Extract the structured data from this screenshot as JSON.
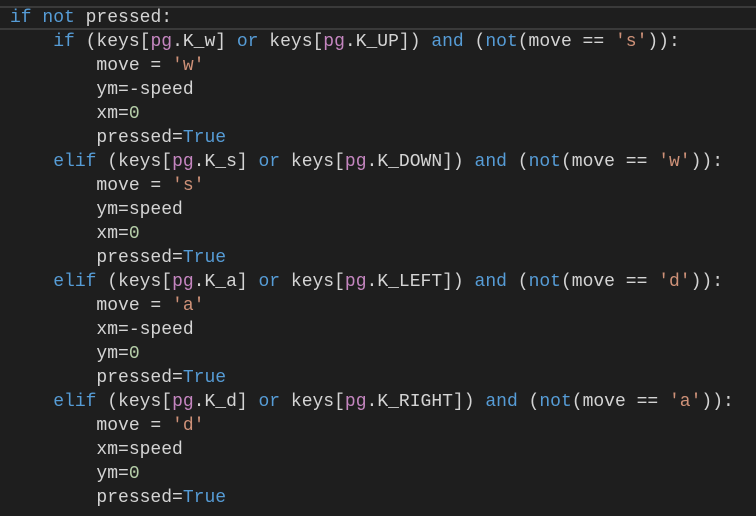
{
  "editor": {
    "colors": {
      "keyword": "#569cd6",
      "module": "#c586c0",
      "string": "#ce9178",
      "number": "#b5cea8",
      "text": "#d4d4d4",
      "background": "#1e1e1e"
    },
    "lines": [
      {
        "indent": 0,
        "current": true,
        "tokens": [
          [
            "kw",
            "if"
          ],
          [
            "txt",
            " "
          ],
          [
            "kw",
            "not"
          ],
          [
            "txt",
            " pressed:"
          ]
        ]
      },
      {
        "indent": 1,
        "tokens": [
          [
            "kw",
            "if"
          ],
          [
            "txt",
            " (keys["
          ],
          [
            "pg",
            "pg"
          ],
          [
            "txt",
            ".K_w] "
          ],
          [
            "kw",
            "or"
          ],
          [
            "txt",
            " keys["
          ],
          [
            "pg",
            "pg"
          ],
          [
            "txt",
            ".K_UP]) "
          ],
          [
            "kw",
            "and"
          ],
          [
            "txt",
            " ("
          ],
          [
            "kw",
            "not"
          ],
          [
            "txt",
            "(move == "
          ],
          [
            "str",
            "'s'"
          ],
          [
            "txt",
            "))："
          ]
        ]
      },
      {
        "indent": 2,
        "tokens": [
          [
            "txt",
            "move = "
          ],
          [
            "str",
            "'w'"
          ]
        ]
      },
      {
        "indent": 2,
        "tokens": [
          [
            "txt",
            "ym=-speed"
          ]
        ]
      },
      {
        "indent": 2,
        "tokens": [
          [
            "txt",
            "xm="
          ],
          [
            "num",
            "0"
          ]
        ]
      },
      {
        "indent": 2,
        "tokens": [
          [
            "txt",
            "pressed="
          ],
          [
            "kw",
            "True"
          ]
        ]
      },
      {
        "indent": 1,
        "tokens": [
          [
            "kw",
            "elif"
          ],
          [
            "txt",
            " (keys["
          ],
          [
            "pg",
            "pg"
          ],
          [
            "txt",
            ".K_s] "
          ],
          [
            "kw",
            "or"
          ],
          [
            "txt",
            " keys["
          ],
          [
            "pg",
            "pg"
          ],
          [
            "txt",
            ".K_DOWN]) "
          ],
          [
            "kw",
            "and"
          ],
          [
            "txt",
            " ("
          ],
          [
            "kw",
            "not"
          ],
          [
            "txt",
            "(move == "
          ],
          [
            "str",
            "'w'"
          ],
          [
            "txt",
            "))："
          ]
        ]
      },
      {
        "indent": 2,
        "tokens": [
          [
            "txt",
            "move = "
          ],
          [
            "str",
            "'s'"
          ]
        ]
      },
      {
        "indent": 2,
        "tokens": [
          [
            "txt",
            "ym=speed"
          ]
        ]
      },
      {
        "indent": 2,
        "tokens": [
          [
            "txt",
            "xm="
          ],
          [
            "num",
            "0"
          ]
        ]
      },
      {
        "indent": 2,
        "tokens": [
          [
            "txt",
            "pressed="
          ],
          [
            "kw",
            "True"
          ]
        ]
      },
      {
        "indent": 1,
        "tokens": [
          [
            "kw",
            "elif"
          ],
          [
            "txt",
            " (keys["
          ],
          [
            "pg",
            "pg"
          ],
          [
            "txt",
            ".K_a] "
          ],
          [
            "kw",
            "or"
          ],
          [
            "txt",
            " keys["
          ],
          [
            "pg",
            "pg"
          ],
          [
            "txt",
            ".K_LEFT]) "
          ],
          [
            "kw",
            "and"
          ],
          [
            "txt",
            " ("
          ],
          [
            "kw",
            "not"
          ],
          [
            "txt",
            "(move == "
          ],
          [
            "str",
            "'d'"
          ],
          [
            "txt",
            "))："
          ]
        ]
      },
      {
        "indent": 2,
        "tokens": [
          [
            "txt",
            "move = "
          ],
          [
            "str",
            "'a'"
          ]
        ]
      },
      {
        "indent": 2,
        "tokens": [
          [
            "txt",
            "xm=-speed"
          ]
        ]
      },
      {
        "indent": 2,
        "tokens": [
          [
            "txt",
            "ym="
          ],
          [
            "num",
            "0"
          ]
        ]
      },
      {
        "indent": 2,
        "tokens": [
          [
            "txt",
            "pressed="
          ],
          [
            "kw",
            "True"
          ]
        ]
      },
      {
        "indent": 1,
        "tokens": [
          [
            "kw",
            "elif"
          ],
          [
            "txt",
            " (keys["
          ],
          [
            "pg",
            "pg"
          ],
          [
            "txt",
            ".K_d] "
          ],
          [
            "kw",
            "or"
          ],
          [
            "txt",
            " keys["
          ],
          [
            "pg",
            "pg"
          ],
          [
            "txt",
            ".K_RIGHT]) "
          ],
          [
            "kw",
            "and"
          ],
          [
            "txt",
            " ("
          ],
          [
            "kw",
            "not"
          ],
          [
            "txt",
            "(move == "
          ],
          [
            "str",
            "'a'"
          ],
          [
            "txt",
            "))："
          ]
        ]
      },
      {
        "indent": 2,
        "tokens": [
          [
            "txt",
            "move = "
          ],
          [
            "str",
            "'d'"
          ]
        ]
      },
      {
        "indent": 2,
        "tokens": [
          [
            "txt",
            "xm=speed"
          ]
        ]
      },
      {
        "indent": 2,
        "tokens": [
          [
            "txt",
            "ym="
          ],
          [
            "num",
            "0"
          ]
        ]
      },
      {
        "indent": 2,
        "tokens": [
          [
            "txt",
            "pressed="
          ],
          [
            "kw",
            "True"
          ]
        ]
      }
    ]
  }
}
